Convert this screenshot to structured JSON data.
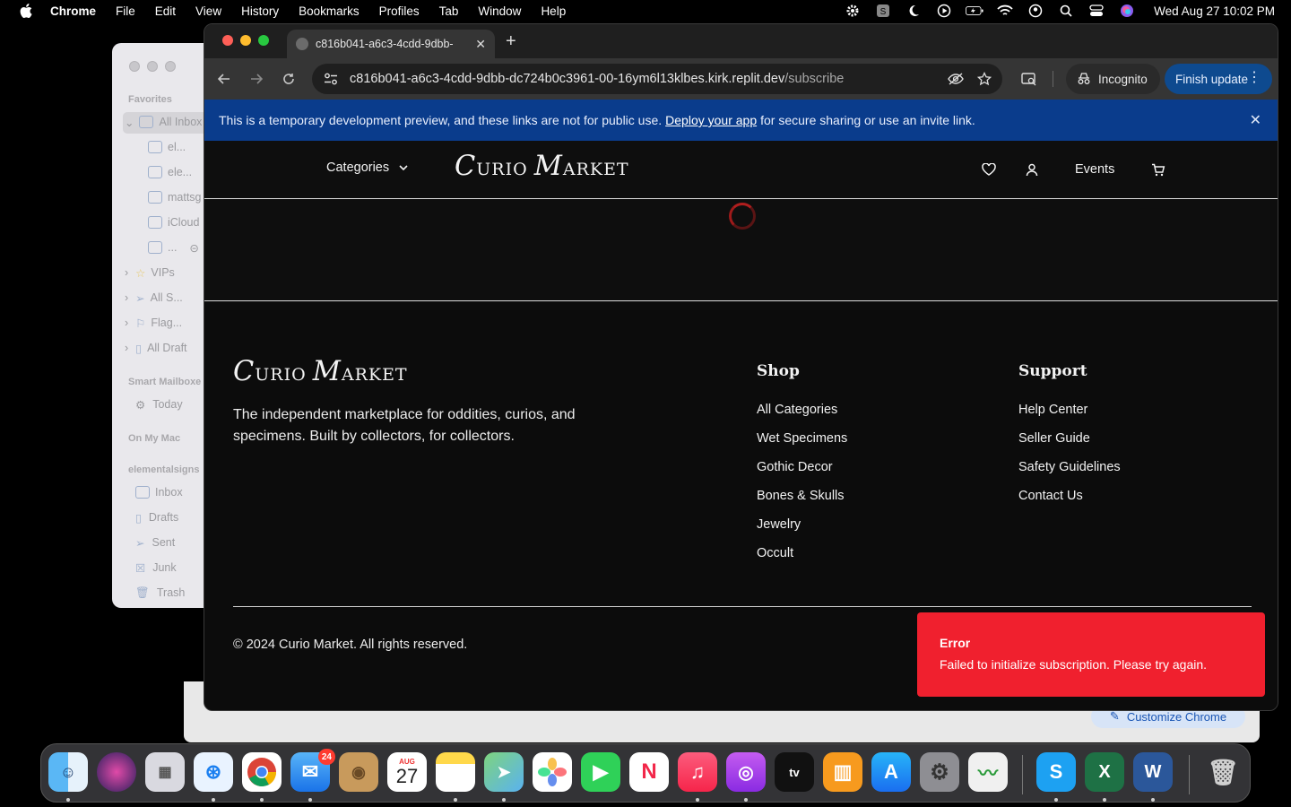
{
  "menubar": {
    "app_name": "Chrome",
    "items": [
      "File",
      "Edit",
      "View",
      "History",
      "Bookmarks",
      "Profiles",
      "Tab",
      "Window",
      "Help"
    ],
    "clock": "Wed Aug 27  10:02 PM"
  },
  "mail": {
    "favorites_header": "Favorites",
    "all_inboxes": "All Inbox",
    "sub_accounts": [
      "el...",
      "ele...",
      "mattsg",
      "iCloud",
      "..."
    ],
    "vips": "VIPs",
    "all_sent": "All S...",
    "flagged": "Flag...",
    "all_drafts": "All Draft",
    "smart_header": "Smart Mailboxe",
    "today": "Today",
    "on_my_mac": "On My Mac",
    "account_header": "elementalsigns",
    "folders": [
      "Inbox",
      "Drafts",
      "Sent",
      "Junk",
      "Trash"
    ]
  },
  "ghost": {
    "customize_label": "Customize Chrome"
  },
  "browser": {
    "tab_title": "c816b041-a6c3-4cdd-9dbb-",
    "url_host": "c816b041-a6c3-4cdd-9dbb-dc724b0c3961-00-16ym6l13klbes.kirk.replit.dev",
    "url_path": "/subscribe",
    "incognito_label": "Incognito",
    "finish_update_label": "Finish update"
  },
  "banner": {
    "text_before": "This is a temporary development preview, and these links are not for public use.",
    "link": "Deploy your app",
    "text_after": "for secure sharing or use an invite link."
  },
  "site": {
    "categories_label": "Categories",
    "logo_c": "C",
    "logo_urio": "URIO",
    "logo_m": "M",
    "logo_arket": "ARKET",
    "events_label": "Events"
  },
  "footer": {
    "tagline": "The independent marketplace for oddities, curios, and specimens. Built by collectors, for collectors.",
    "shop_title": "Shop",
    "shop_links": [
      "All Categories",
      "Wet Specimens",
      "Gothic Decor",
      "Bones & Skulls",
      "Jewelry",
      "Occult"
    ],
    "support_title": "Support",
    "support_links": [
      "Help Center",
      "Seller Guide",
      "Safety Guidelines",
      "Contact Us"
    ],
    "copyright": "© 2024 Curio Market. All rights reserved."
  },
  "toast": {
    "title": "Error",
    "message": "Failed to initialize subscription. Please try again."
  },
  "dock": {
    "mail_badge": "24",
    "calendar_month": "AUG",
    "calendar_day": "27"
  },
  "colors": {
    "banner_bg": "#0a3c8c",
    "toast_bg": "#f0202e",
    "finish_update_bg": "#0e4a8f",
    "spinner": "#b01e1e"
  }
}
